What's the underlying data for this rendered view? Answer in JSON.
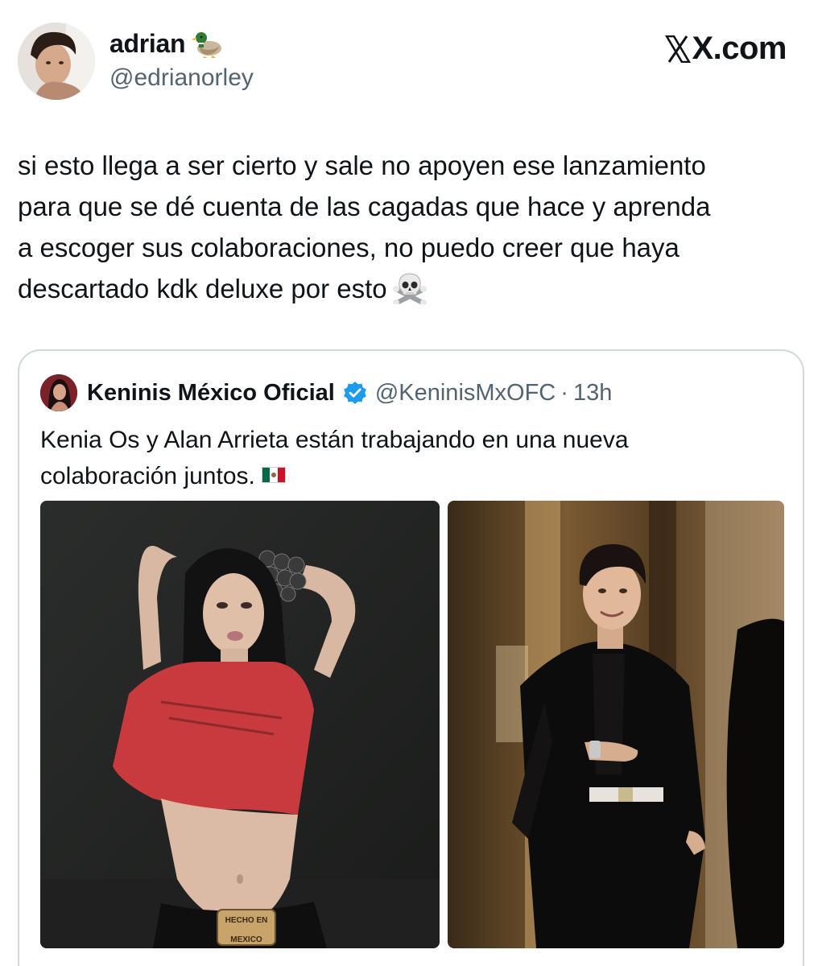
{
  "tweet": {
    "author": {
      "name": "adrian",
      "name_emoji": "duck-emoji",
      "handle": "@edrianorley",
      "avatar": "profile photo"
    },
    "brand": "X.com",
    "text": "si esto llega a ser cierto y sale no apoyen ese lanzamiento\npara que se dé cuenta de las cagadas que hace y aprenda\na escoger sus colaboraciones, no puedo creer que haya\ndescartado kdk deluxe por esto",
    "text_emoji": "skull-and-crossbones-emoji"
  },
  "quoted_tweet": {
    "author": {
      "name": "Keninis México Oficial",
      "verified": true,
      "handle": "@KeninisMxOFC",
      "separator": "·",
      "time": "13h"
    },
    "text": "Kenia Os y Alan Arrieta están trabajando en una nueva\ncolaboración juntos.",
    "text_emoji": "mexico-flag-emoji",
    "media": [
      {
        "kind": "photo",
        "icon": "photo-woman-red-top"
      },
      {
        "kind": "photo",
        "icon": "photo-man-black-suit"
      }
    ],
    "belt_text_1": "HECHO EN",
    "belt_text_2": "MEXICO"
  },
  "colors": {
    "text": "#0f1419",
    "secondary_text": "#536471",
    "border": "#cfd9de",
    "verified_blue": "#1d9bf0"
  }
}
